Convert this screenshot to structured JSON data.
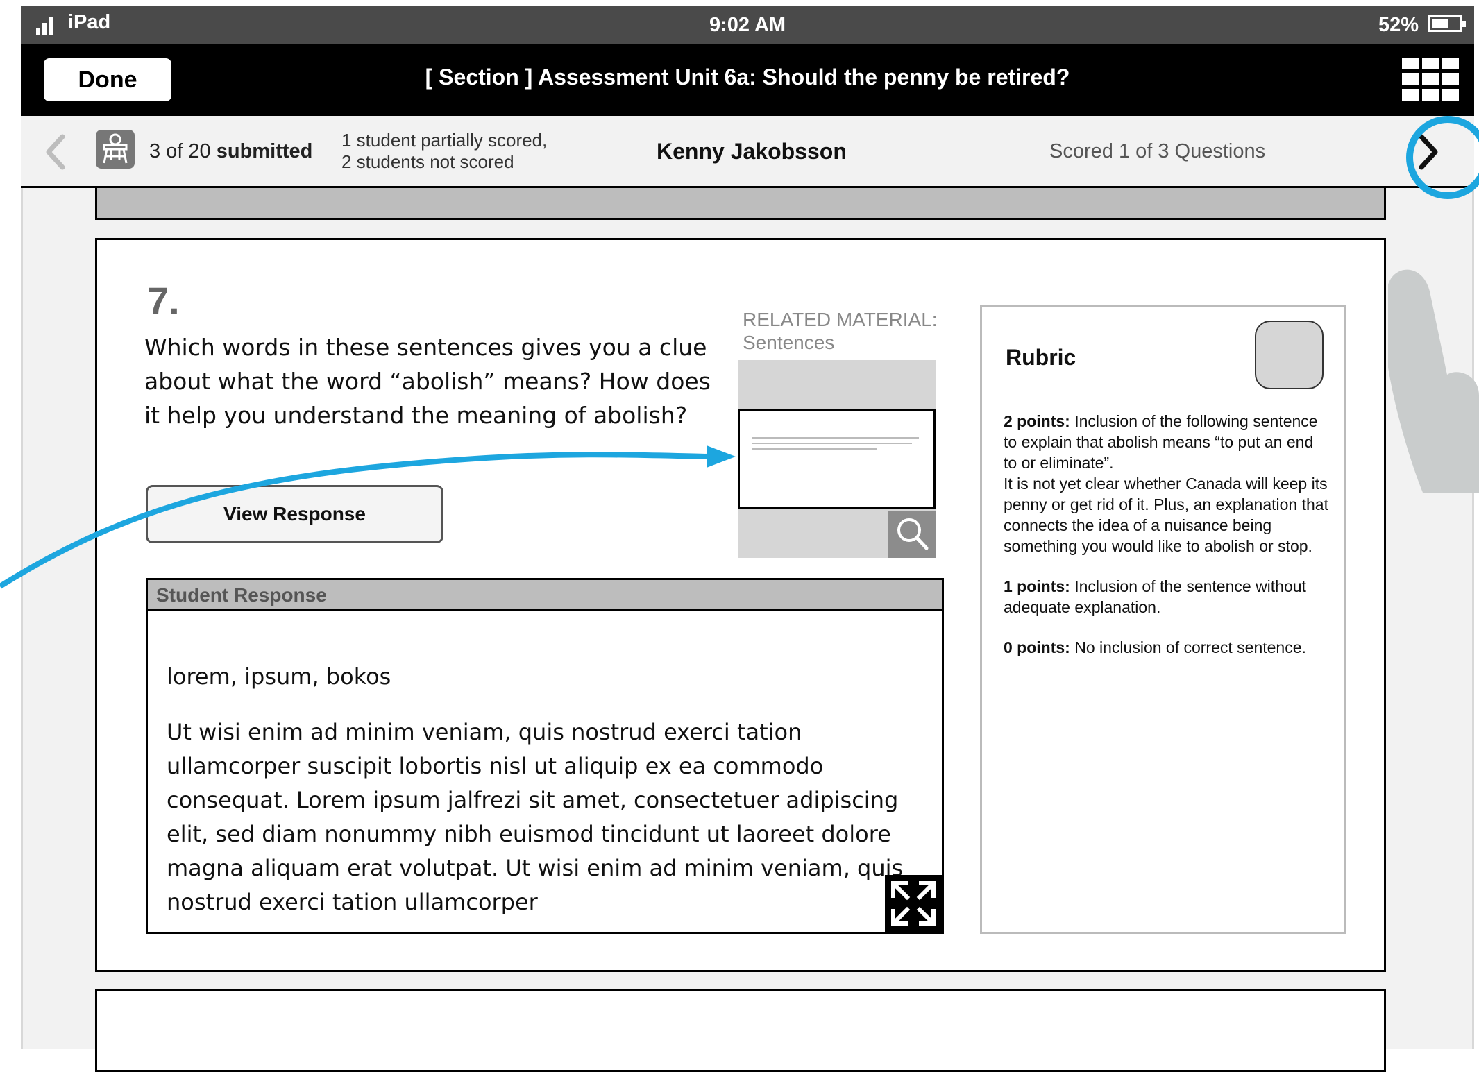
{
  "status_bar": {
    "carrier": "iPad",
    "time": "9:02 AM",
    "battery": "52%"
  },
  "nav_bar": {
    "done_label": "Done",
    "title": "[ Section ] Assessment Unit 6a: Should the penny be retired?"
  },
  "student_bar": {
    "submitted_count": "3 of 20",
    "submitted_word": "submitted",
    "score_note_line1": "1 student partially scored,",
    "score_note_line2": "2 students not scored",
    "student_name": "Kenny Jakobsson",
    "scored_status": "Scored 1 of 3 Questions"
  },
  "question": {
    "number": "7.",
    "text": "Which words in these sentences gives you a clue about what the word “abolish” means?  How does it help you understand the meaning of abolish?",
    "view_response_label": "View Response"
  },
  "related_material": {
    "label": "RELATED MATERIAL:",
    "title": "Sentences"
  },
  "student_response": {
    "header": "Student Response",
    "words": "lorem, ipsum, bokos",
    "body": "Ut wisi enim ad minim veniam, quis nostrud exerci tation ullamcorper suscipit lobortis nisl ut aliquip ex ea commodo consequat. Lorem ipsum jalfrezi sit amet, consectetuer adipiscing elit, sed diam nonummy nibh euismod tincidunt ut laoreet dolore magna aliquam erat volutpat. Ut wisi enim ad minim veniam, quis nostrud exerci tation ullamcorper"
  },
  "rubric": {
    "title": "Rubric",
    "levels": [
      {
        "points": "2 points:",
        "text": " Inclusion of the following sentence to explain that abolish means “to put an end to or eliminate”.",
        "text2": "It is not yet clear whether Canada will keep its penny or get rid of it.  Plus, an explanation that connects the idea of a nuisance being something you would like to abolish or stop."
      },
      {
        "points": "1 points:",
        "text": " Inclusion of the sentence without adequate explanation."
      },
      {
        "points": "0 points:",
        "text": "  No inclusion of correct sentence."
      }
    ]
  },
  "colors": {
    "accent_blue": "#1da6df",
    "nav_black": "#000000",
    "status_gray": "#4a4a4a"
  }
}
